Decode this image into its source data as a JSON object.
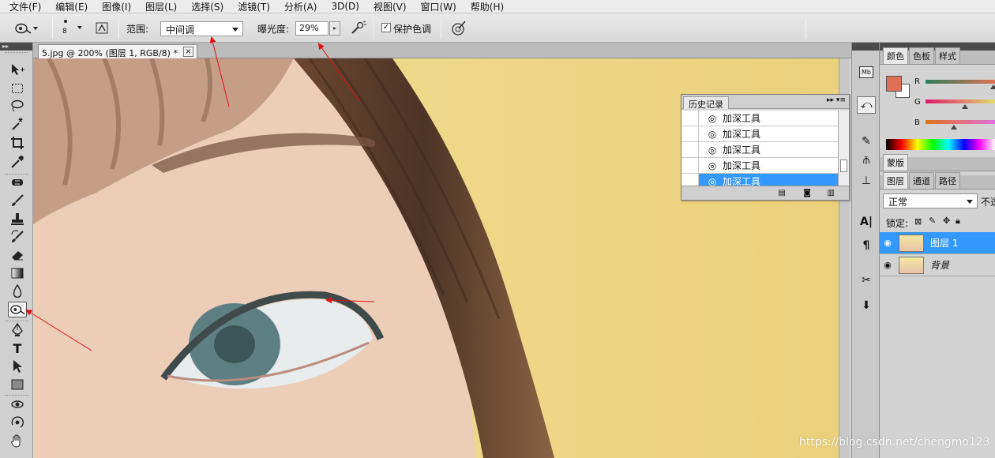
{
  "menubar": {
    "items": [
      "文件(F)",
      "编辑(E)",
      "图像(I)",
      "图层(L)",
      "选择(S)",
      "滤镜(T)",
      "分析(A)",
      "3D(D)",
      "视图(V)",
      "窗口(W)",
      "帮助(H)"
    ]
  },
  "options": {
    "brush_size": "8",
    "range_label": "范围:",
    "range_value": "中间调",
    "exposure_label": "曝光度:",
    "exposure_value": "29%",
    "protect_label": "保护色调",
    "protect_checked": true
  },
  "document": {
    "tab_title": "5.jpg @ 200% (图层 1, RGB/8) *",
    "close_glyph": "×"
  },
  "history": {
    "title": "历史记录",
    "items": [
      "加深工具",
      "加深工具",
      "加深工具",
      "加深工具",
      "加深工具"
    ],
    "selected_index": 4
  },
  "color_panel": {
    "tabs": [
      "颜色",
      "色板",
      "样式"
    ],
    "channels": [
      "R",
      "G",
      "B"
    ],
    "foreground": "#e07055",
    "background": "#ffffff"
  },
  "mask_panel": {
    "tab": "蒙版"
  },
  "layers_panel": {
    "tabs": [
      "图层",
      "通道",
      "路径"
    ],
    "blend_mode": "正常",
    "opacity_label": "不透",
    "lock_label": "锁定:",
    "layers": [
      {
        "name": "图层 1",
        "selected": true
      },
      {
        "name": "背景",
        "selected": false
      }
    ]
  },
  "watermark": "https://blog.csdn.net/chengmo123",
  "colors": {
    "selection": "#3399ff",
    "annotation_arrow": "#e01010"
  },
  "icons": {
    "options_tool": "burn-tool-icon",
    "toolbox": [
      "move-icon",
      "marquee-icon",
      "lasso-icon",
      "magic-wand-icon",
      "crop-icon",
      "eyedropper-icon",
      "healing-brush-icon",
      "brush-icon",
      "clone-stamp-icon",
      "history-brush-icon",
      "eraser-icon",
      "gradient-icon",
      "blur-icon",
      "burn-tool-icon",
      "pen-icon",
      "type-icon",
      "path-selection-icon",
      "rectangle-icon",
      "3d-rotate-icon",
      "3d-orbit-icon",
      "hand-icon"
    ]
  }
}
